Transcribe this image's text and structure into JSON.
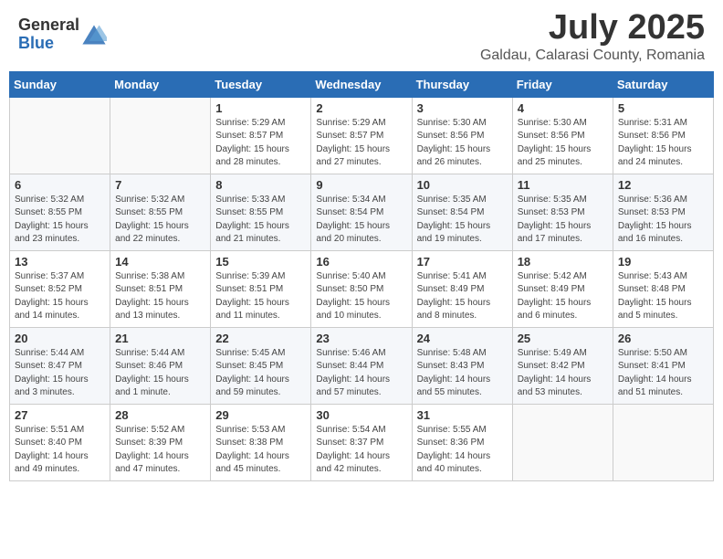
{
  "header": {
    "logo_general": "General",
    "logo_blue": "Blue",
    "month_year": "July 2025",
    "location": "Galdau, Calarasi County, Romania"
  },
  "weekdays": [
    "Sunday",
    "Monday",
    "Tuesday",
    "Wednesday",
    "Thursday",
    "Friday",
    "Saturday"
  ],
  "weeks": [
    [
      {
        "day": "",
        "info": ""
      },
      {
        "day": "",
        "info": ""
      },
      {
        "day": "1",
        "info": "Sunrise: 5:29 AM\nSunset: 8:57 PM\nDaylight: 15 hours\nand 28 minutes."
      },
      {
        "day": "2",
        "info": "Sunrise: 5:29 AM\nSunset: 8:57 PM\nDaylight: 15 hours\nand 27 minutes."
      },
      {
        "day": "3",
        "info": "Sunrise: 5:30 AM\nSunset: 8:56 PM\nDaylight: 15 hours\nand 26 minutes."
      },
      {
        "day": "4",
        "info": "Sunrise: 5:30 AM\nSunset: 8:56 PM\nDaylight: 15 hours\nand 25 minutes."
      },
      {
        "day": "5",
        "info": "Sunrise: 5:31 AM\nSunset: 8:56 PM\nDaylight: 15 hours\nand 24 minutes."
      }
    ],
    [
      {
        "day": "6",
        "info": "Sunrise: 5:32 AM\nSunset: 8:55 PM\nDaylight: 15 hours\nand 23 minutes."
      },
      {
        "day": "7",
        "info": "Sunrise: 5:32 AM\nSunset: 8:55 PM\nDaylight: 15 hours\nand 22 minutes."
      },
      {
        "day": "8",
        "info": "Sunrise: 5:33 AM\nSunset: 8:55 PM\nDaylight: 15 hours\nand 21 minutes."
      },
      {
        "day": "9",
        "info": "Sunrise: 5:34 AM\nSunset: 8:54 PM\nDaylight: 15 hours\nand 20 minutes."
      },
      {
        "day": "10",
        "info": "Sunrise: 5:35 AM\nSunset: 8:54 PM\nDaylight: 15 hours\nand 19 minutes."
      },
      {
        "day": "11",
        "info": "Sunrise: 5:35 AM\nSunset: 8:53 PM\nDaylight: 15 hours\nand 17 minutes."
      },
      {
        "day": "12",
        "info": "Sunrise: 5:36 AM\nSunset: 8:53 PM\nDaylight: 15 hours\nand 16 minutes."
      }
    ],
    [
      {
        "day": "13",
        "info": "Sunrise: 5:37 AM\nSunset: 8:52 PM\nDaylight: 15 hours\nand 14 minutes."
      },
      {
        "day": "14",
        "info": "Sunrise: 5:38 AM\nSunset: 8:51 PM\nDaylight: 15 hours\nand 13 minutes."
      },
      {
        "day": "15",
        "info": "Sunrise: 5:39 AM\nSunset: 8:51 PM\nDaylight: 15 hours\nand 11 minutes."
      },
      {
        "day": "16",
        "info": "Sunrise: 5:40 AM\nSunset: 8:50 PM\nDaylight: 15 hours\nand 10 minutes."
      },
      {
        "day": "17",
        "info": "Sunrise: 5:41 AM\nSunset: 8:49 PM\nDaylight: 15 hours\nand 8 minutes."
      },
      {
        "day": "18",
        "info": "Sunrise: 5:42 AM\nSunset: 8:49 PM\nDaylight: 15 hours\nand 6 minutes."
      },
      {
        "day": "19",
        "info": "Sunrise: 5:43 AM\nSunset: 8:48 PM\nDaylight: 15 hours\nand 5 minutes."
      }
    ],
    [
      {
        "day": "20",
        "info": "Sunrise: 5:44 AM\nSunset: 8:47 PM\nDaylight: 15 hours\nand 3 minutes."
      },
      {
        "day": "21",
        "info": "Sunrise: 5:44 AM\nSunset: 8:46 PM\nDaylight: 15 hours\nand 1 minute."
      },
      {
        "day": "22",
        "info": "Sunrise: 5:45 AM\nSunset: 8:45 PM\nDaylight: 14 hours\nand 59 minutes."
      },
      {
        "day": "23",
        "info": "Sunrise: 5:46 AM\nSunset: 8:44 PM\nDaylight: 14 hours\nand 57 minutes."
      },
      {
        "day": "24",
        "info": "Sunrise: 5:48 AM\nSunset: 8:43 PM\nDaylight: 14 hours\nand 55 minutes."
      },
      {
        "day": "25",
        "info": "Sunrise: 5:49 AM\nSunset: 8:42 PM\nDaylight: 14 hours\nand 53 minutes."
      },
      {
        "day": "26",
        "info": "Sunrise: 5:50 AM\nSunset: 8:41 PM\nDaylight: 14 hours\nand 51 minutes."
      }
    ],
    [
      {
        "day": "27",
        "info": "Sunrise: 5:51 AM\nSunset: 8:40 PM\nDaylight: 14 hours\nand 49 minutes."
      },
      {
        "day": "28",
        "info": "Sunrise: 5:52 AM\nSunset: 8:39 PM\nDaylight: 14 hours\nand 47 minutes."
      },
      {
        "day": "29",
        "info": "Sunrise: 5:53 AM\nSunset: 8:38 PM\nDaylight: 14 hours\nand 45 minutes."
      },
      {
        "day": "30",
        "info": "Sunrise: 5:54 AM\nSunset: 8:37 PM\nDaylight: 14 hours\nand 42 minutes."
      },
      {
        "day": "31",
        "info": "Sunrise: 5:55 AM\nSunset: 8:36 PM\nDaylight: 14 hours\nand 40 minutes."
      },
      {
        "day": "",
        "info": ""
      },
      {
        "day": "",
        "info": ""
      }
    ]
  ]
}
